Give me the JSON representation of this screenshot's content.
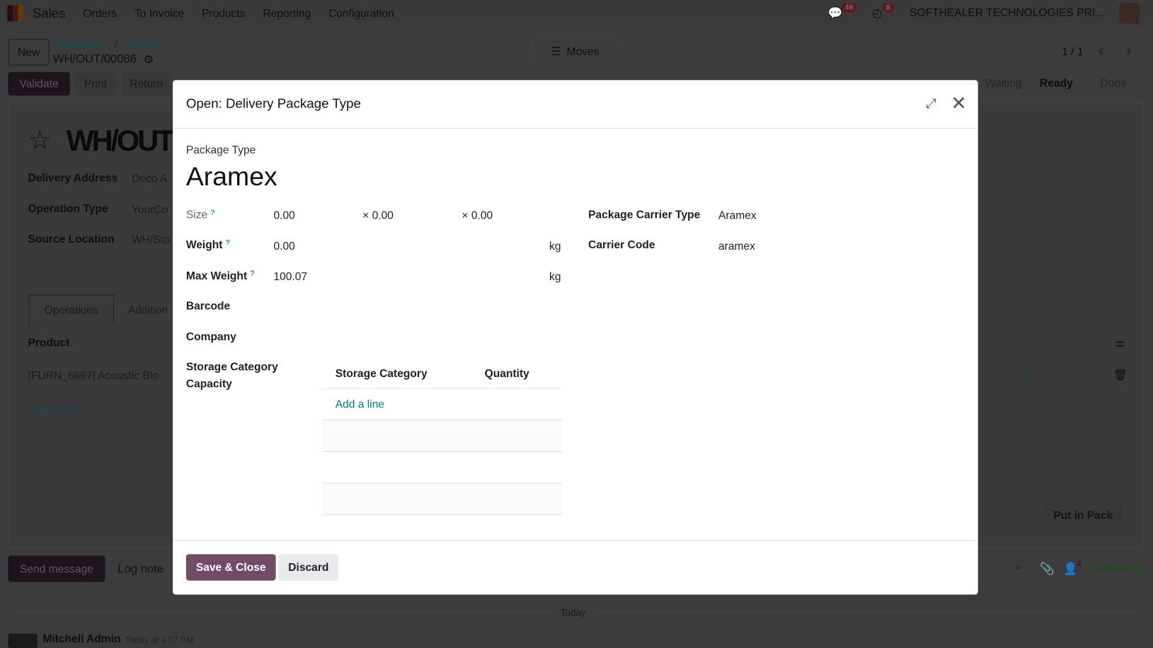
{
  "nav": {
    "app": "Sales",
    "menu": [
      "Orders",
      "To Invoice",
      "Products",
      "Reporting",
      "Configuration"
    ],
    "messages_count": "49",
    "activities_count": "8",
    "company": "SOFTHEALER TECHNOLOGIES PRI..."
  },
  "control": {
    "new": "New",
    "breadcrumb": [
      "Quotations",
      "S00103"
    ],
    "record": "WH/OUT/00086",
    "moves": "Moves",
    "pager": "1 / 1"
  },
  "actions": [
    "Validate",
    "Print",
    "Return"
  ],
  "stages": [
    "Waiting",
    "Ready",
    "Done"
  ],
  "form": {
    "title": "WH/OUT",
    "fields": [
      {
        "label": "Delivery Address",
        "value": "Deco A"
      },
      {
        "label": "Operation Type",
        "value": "YourCo"
      },
      {
        "label": "Source Location",
        "value": "WH/Sto"
      }
    ],
    "tabs": [
      "Operations",
      "Addition"
    ],
    "col_product": "Product",
    "row": "[FURN_6667] Acoustic Blo",
    "add_line": "Add a line",
    "put_in_pack": "Put in Pack"
  },
  "chatter": {
    "send": "Send message",
    "log": "Log note",
    "followers": "2",
    "following": "Following",
    "today": "Today",
    "author": "Mitchell Admin",
    "time": "Today at 4:57 PM"
  },
  "modal": {
    "title": "Open: Delivery Package Type",
    "name_label": "Package Type",
    "name": "Aramex",
    "size_label": "Size",
    "size": [
      "0.00",
      "× 0.00",
      "× 0.00"
    ],
    "weight_label": "Weight",
    "weight": "0.00",
    "unit": "kg",
    "max_weight_label": "Max Weight",
    "max_weight": "100.07",
    "barcode_label": "Barcode",
    "company_label": "Company",
    "storage_label_1": "Storage Category",
    "storage_label_2": "Capacity",
    "table_cols": [
      "Storage Category",
      "Quantity"
    ],
    "add_line": "Add a line",
    "carrier_type_label": "Package Carrier Type",
    "carrier_type": "Aramex",
    "carrier_code_label": "Carrier Code",
    "carrier_code": "aramex",
    "save": "Save & Close",
    "discard": "Discard",
    "help": "?"
  },
  "colors": {
    "primary": "#714b67",
    "link": "#017e84"
  }
}
